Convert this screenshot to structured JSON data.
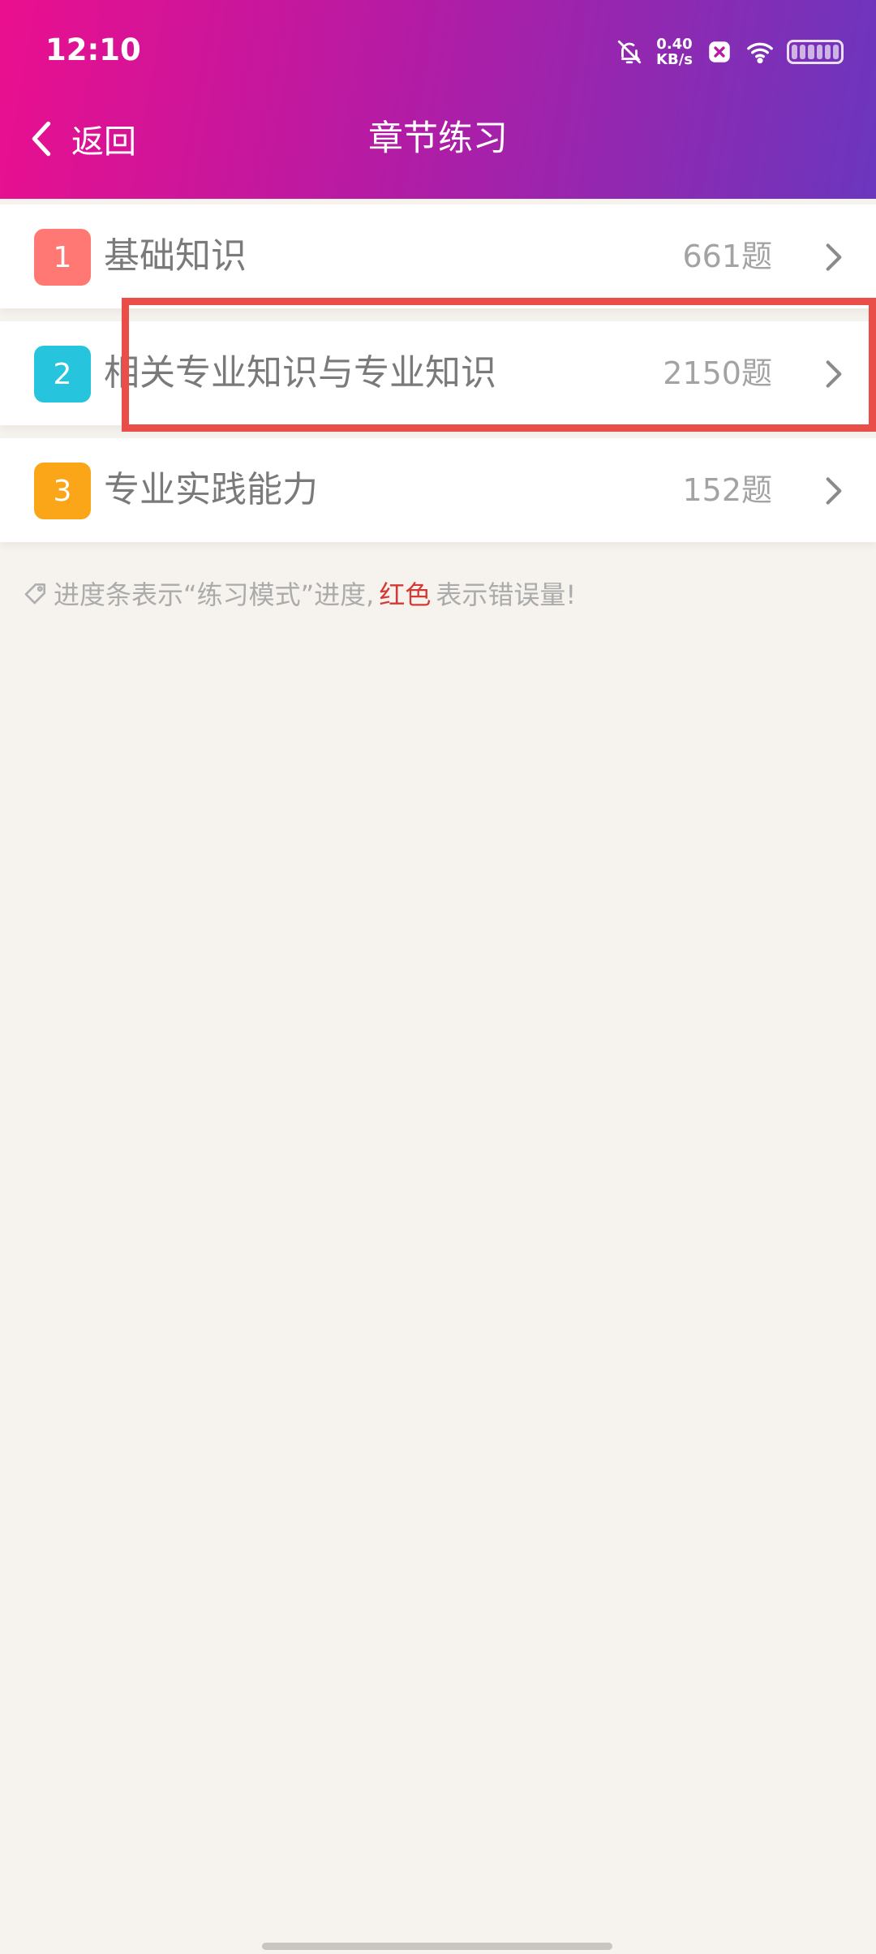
{
  "status_bar": {
    "time": "12:10",
    "net_speed_value": "0.40",
    "net_speed_unit": "KB/s",
    "icons": [
      "bell-off-icon",
      "vpn-icon",
      "wifi-icon",
      "battery-icon"
    ]
  },
  "header": {
    "back_label": "返回",
    "title": "章节练习",
    "gradient_colors": [
      "#ea0f8e",
      "#b51ba4",
      "#6b36be"
    ]
  },
  "chapters": [
    {
      "number": "1",
      "title": "基础知识",
      "count": "661题",
      "badge_color": "#ff7873"
    },
    {
      "number": "2",
      "title": "相关专业知识与专业知识",
      "count": "2150题",
      "badge_color": "#26c4dd"
    },
    {
      "number": "3",
      "title": "专业实践能力",
      "count": "152题",
      "badge_color": "#fba619"
    }
  ],
  "highlight": {
    "target": "chapter 2",
    "color": "#ea4e49"
  },
  "note": {
    "prefix": "进度条表示“练习模式”进度,",
    "red_text": "红色",
    "suffix": "表示错误量!"
  }
}
